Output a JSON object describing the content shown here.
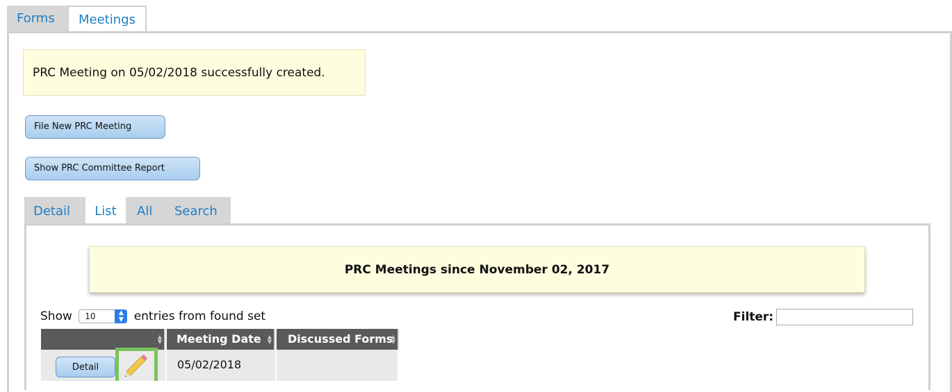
{
  "top_tabs": [
    "Forms",
    "Meetings"
  ],
  "alert_message": "PRC Meeting on 05/02/2018 successfully created.",
  "buttons": {
    "new_meeting": "File New PRC Meeting",
    "committee_report": "Show PRC Committee Report"
  },
  "inner_tabs": [
    "Detail",
    "List",
    "All",
    "Search"
  ],
  "banner": "PRC Meetings since November 02, 2017",
  "list_controls": {
    "show_label": "Show",
    "page_size": "10",
    "entries_label": "entries from found set",
    "filter_label": "Filter:",
    "filter_value": ""
  },
  "table": {
    "columns": [
      "",
      "Meeting Date",
      "Discussed Forms"
    ],
    "rows": [
      {
        "action_label": "Detail",
        "meeting_date": "05/02/2018",
        "discussed_forms": ""
      }
    ]
  },
  "icons": {
    "edit": "pencil-icon",
    "sort": "sort-arrows-icon",
    "select_arrow": "up-down-arrows-icon"
  },
  "colors": {
    "tab_link": "#1f7fc3",
    "alert_bg": "#fefedf",
    "button_bg": "#bcd8f4",
    "table_header_bg": "#5a5a5a",
    "edit_highlight": "#7bc35d"
  }
}
